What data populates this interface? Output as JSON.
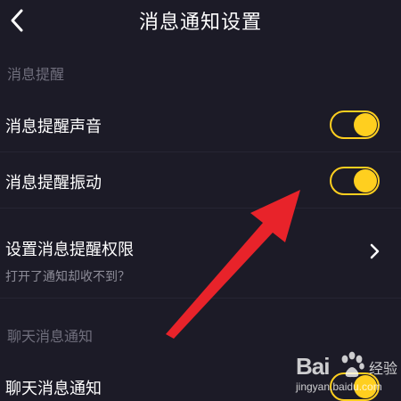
{
  "header": {
    "title": "消息通知设置"
  },
  "sections": [
    {
      "title": "消息提醒",
      "rows": [
        {
          "label": "消息提醒声音",
          "control": "toggle",
          "on": true
        },
        {
          "label": "消息提醒振动",
          "control": "toggle",
          "on": true
        },
        {
          "label": "设置消息提醒权限",
          "subtitle": "打开了通知却收不到？",
          "control": "chevron"
        }
      ]
    },
    {
      "title": "聊天消息通知",
      "rows": [
        {
          "label": "聊天消息通知",
          "control": "toggle",
          "on": true
        }
      ]
    }
  ],
  "icons": {
    "back": "chevron-left-icon",
    "row_chevron": "chevron-right-icon",
    "annotation": "red-arrow-icon"
  },
  "colors": {
    "background": "#1c1b27",
    "accent": "#ffcf1f",
    "annotation": "#e8232a"
  },
  "watermark": {
    "logo_text": "Bai",
    "brand_text": "经验",
    "url": "jingyan.baidu.com"
  }
}
